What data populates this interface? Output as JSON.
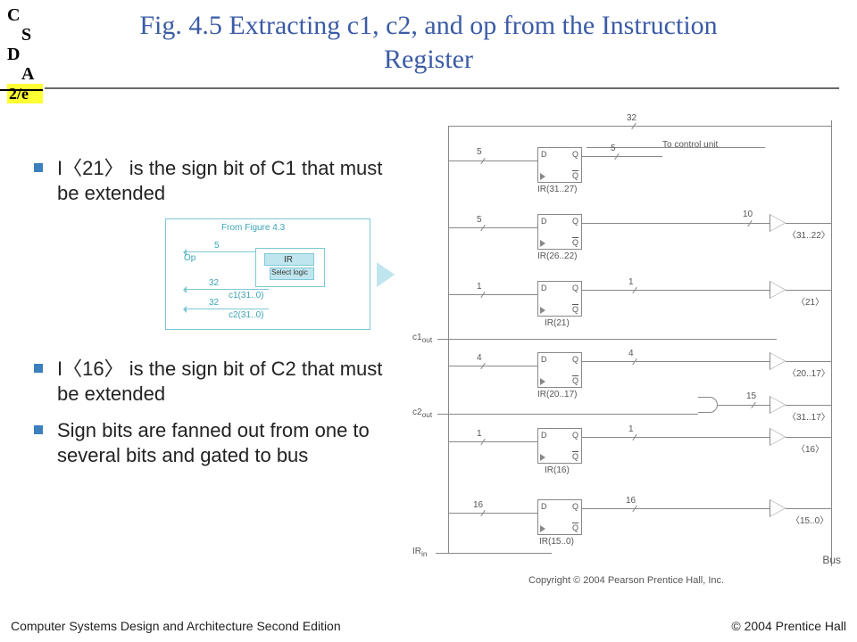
{
  "logo": {
    "c": "C",
    "s": "S",
    "d": "D",
    "a": "A",
    "ed": "2/e"
  },
  "title": "Fig. 4.5  Extracting c1, c2, and op from the Instruction Register",
  "bullets": [
    "I〈21〉 is the sign bit of C1 that must be extended",
    "I〈16〉 is the sign bit of C2 that must be extended",
    "Sign bits are fanned out from one to several bits and gated to bus"
  ],
  "inset": {
    "caption": "From Figure 4.3",
    "op": "Op",
    "ir": "IR",
    "sel": "Select logic",
    "w5": "5",
    "w32a": "32",
    "w32b": "32",
    "c1": "c1(31..0)",
    "c2": "c2(31..0)"
  },
  "diagram": {
    "top_bus": "32",
    "to_control": "To control unit",
    "rows": [
      {
        "wL": "5",
        "name": "IR(31..27)",
        "wR": "5",
        "out": ""
      },
      {
        "wL": "5",
        "name": "IR(26..22)",
        "wR": "",
        "out": "〈31..22〉",
        "outW": "10"
      },
      {
        "wL": "1",
        "name": "IR(21)",
        "wR": "1",
        "out": "〈21〉"
      },
      {
        "wL": "4",
        "name": "IR(20..17)",
        "wR": "4",
        "out": "〈20..17〉"
      },
      {
        "wL": "1",
        "name": "IR(16)",
        "wR": "1",
        "out": "〈16〉",
        "outAlt": "〈31..17〉",
        "outAltW": "15"
      },
      {
        "wL": "16",
        "name": "IR(15..0)",
        "wR": "16",
        "out": "〈15..0〉"
      }
    ],
    "c1out": "c1",
    "c1sub": "out",
    "c2out": "c2",
    "c2sub": "out",
    "irin": "IR",
    "irinsub": "in",
    "bus": "Bus",
    "d": "D",
    "q": "Q",
    "qb": "Q",
    "copyright": "Copyright © 2004 Pearson Prentice Hall, Inc."
  },
  "footer": {
    "left": "Computer Systems Design and Architecture Second Edition",
    "right": "© 2004 Prentice Hall"
  }
}
